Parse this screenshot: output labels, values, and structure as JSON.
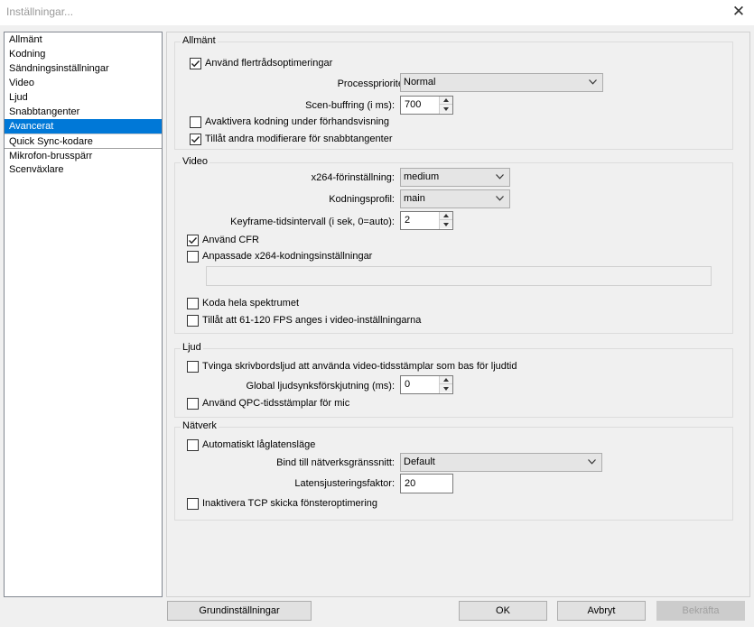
{
  "window": {
    "title": "Inställningar..."
  },
  "sidebar": {
    "items": [
      {
        "label": "Allmänt"
      },
      {
        "label": "Kodning"
      },
      {
        "label": "Sändningsinställningar"
      },
      {
        "label": "Video"
      },
      {
        "label": "Ljud"
      },
      {
        "label": "Snabbtangenter"
      },
      {
        "label": "Avancerat"
      },
      {
        "label": "Quick Sync-kodare"
      },
      {
        "label": "Mikrofon-brusspärr"
      },
      {
        "label": "Scenväxlare"
      }
    ],
    "selected": "Avancerat"
  },
  "general": {
    "legend": "Allmänt",
    "multithread_label": "Använd flertrådsoptimeringar",
    "multithread_checked": true,
    "priority_label": "Processprioritet",
    "priority_value": "Normal",
    "buffer_label": "Scen-buffring (i ms):",
    "buffer_value": "700",
    "disable_preview_label": "Avaktivera kodning under förhandsvisning",
    "disable_preview_checked": false,
    "allow_modifiers_label": "Tillåt andra modifierare för snabbtangenter",
    "allow_modifiers_checked": true
  },
  "video": {
    "legend": "Video",
    "preset_label": "x264-förinställning:",
    "preset_value": "medium",
    "profile_label": "Kodningsprofil:",
    "profile_value": "main",
    "keyframe_label": "Keyframe-tidsintervall (i sek, 0=auto):",
    "keyframe_value": "2",
    "cfr_label": "Använd CFR",
    "cfr_checked": true,
    "custom_x264_label": "Anpassade x264-kodningsinställningar",
    "custom_x264_checked": false,
    "custom_x264_value": "",
    "full_range_label": "Koda hela spektrumet",
    "full_range_checked": false,
    "fps_label": "Tillåt att 61-120 FPS anges i video-inställningarna",
    "fps_checked": false
  },
  "audio": {
    "legend": "Ljud",
    "force_timestamps_label": "Tvinga skrivbordsljud att använda video-tidsstämplar som bas för ljudtid",
    "force_timestamps_checked": false,
    "sync_offset_label": "Global ljudsynksförskjutning (ms):",
    "sync_offset_value": "0",
    "qpc_label": "Använd QPC-tidsstämplar för mic",
    "qpc_checked": false
  },
  "network": {
    "legend": "Nätverk",
    "low_latency_label": "Automatiskt låglatensläge",
    "low_latency_checked": false,
    "bind_label": "Bind till nätverksgränssnitt:",
    "bind_value": "Default",
    "latency_factor_label": "Latensjusteringsfaktor:",
    "latency_factor_value": "20",
    "disable_tcp_label": "Inaktivera TCP skicka fönsteroptimering",
    "disable_tcp_checked": false
  },
  "footer": {
    "defaults_label": "Grundinställningar",
    "ok_label": "OK",
    "cancel_label": "Avbryt",
    "apply_label": "Bekräfta"
  }
}
